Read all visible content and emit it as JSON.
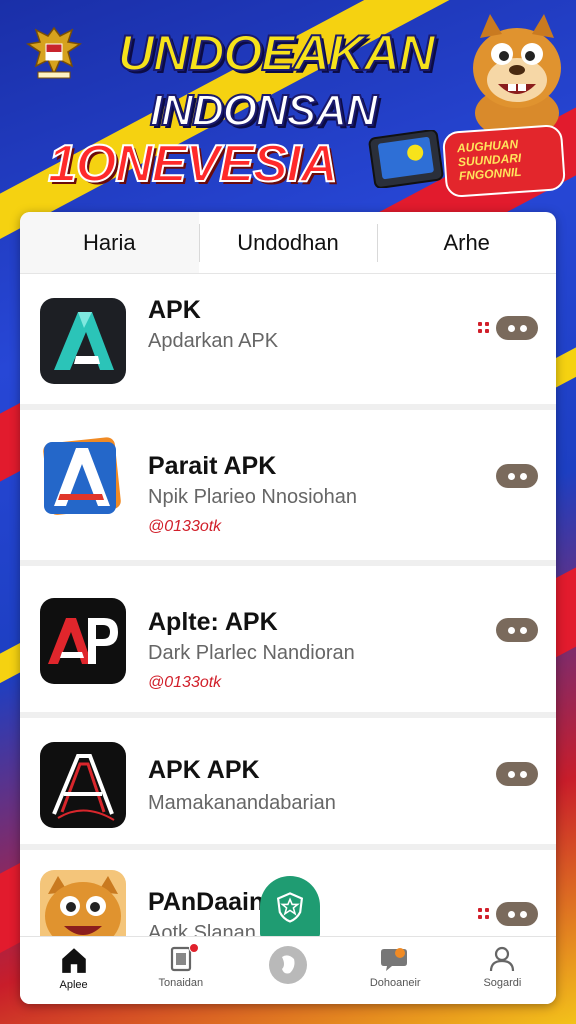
{
  "header": {
    "title_line1": "UNDOEAKAN",
    "title_line2": "INDONSAN",
    "title_line3": "1ONEVESIA",
    "promo_badge": "AUGHUAN SUUNDARI FNGONNIL"
  },
  "tabs": [
    {
      "label": "Haria"
    },
    {
      "label": "Undodhan"
    },
    {
      "label": "Arhe"
    }
  ],
  "apps": [
    {
      "name": "APK",
      "desc": "Apdarkan APK",
      "meta": "",
      "icon": "teal-a-logo-icon"
    },
    {
      "name": "Parait APK",
      "desc": "Npik Plarieo Nnosiohan",
      "meta": "@0133otk",
      "icon": "orange-a-logo-icon"
    },
    {
      "name": "Aplte: APK",
      "desc": "Dark Plarlec Nandioran",
      "meta": "@0133otk",
      "icon": "ap-logo-icon"
    },
    {
      "name": "APK APK",
      "desc": "Mamakanandabarian",
      "meta": "",
      "icon": "sketch-a-logo-icon"
    },
    {
      "name": "PAnDaain",
      "desc": "Aotk Slanan  aanm",
      "meta": "",
      "icon": "mascot-face-icon"
    }
  ],
  "bottom_nav": [
    {
      "label": "Aplee",
      "icon": "home-icon"
    },
    {
      "label": "Tonaidan",
      "icon": "bookmark-icon"
    },
    {
      "label": "",
      "icon": "map-icon"
    },
    {
      "label": "Dohoaneir",
      "icon": "chat-icon"
    },
    {
      "label": "Sogardi",
      "icon": "user-icon"
    }
  ],
  "colors": {
    "accent_green": "#1f9c72",
    "more_button": "#7a6a5c",
    "meta_red": "#d11f2a",
    "header_yellow": "#f7e31b"
  }
}
